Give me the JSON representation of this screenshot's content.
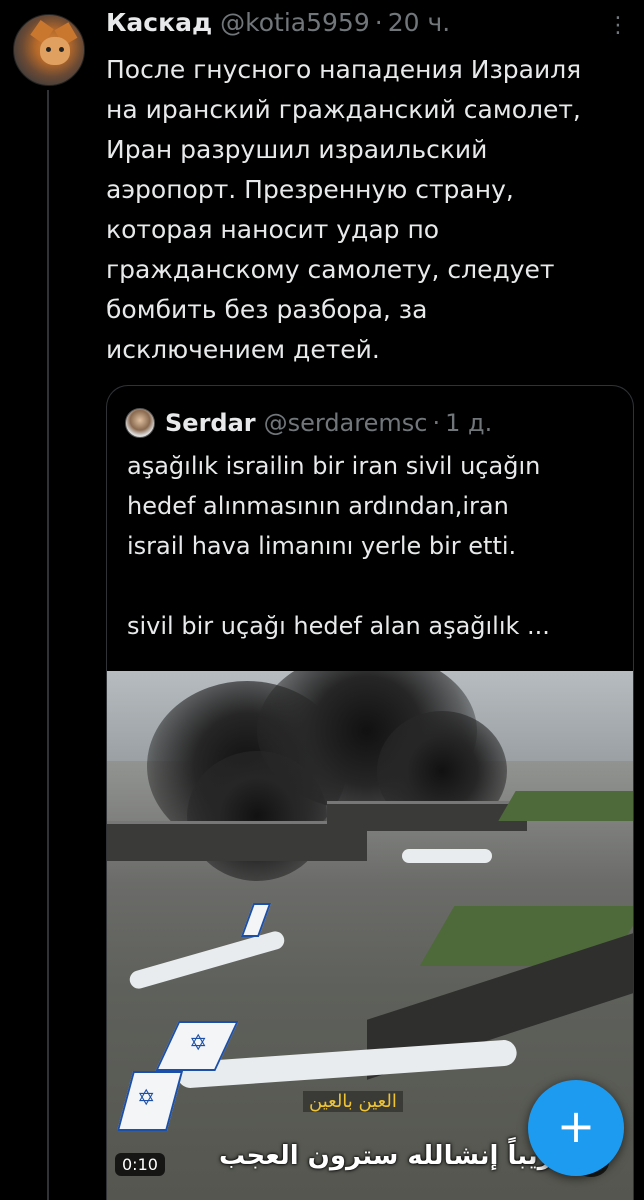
{
  "tweet": {
    "author_name": "Каскад",
    "author_handle": "@kotia5959",
    "separator": "·",
    "time": "20 ч.",
    "lines": [
      "После гнусного нападения Израиля",
      "на иранский гражданский самолет,",
      "Иран разрушил израильский",
      "аэропорт.  Презренную страну,",
      "которая наносит удар по",
      "гражданскому самолету, следует",
      "бомбить без разбора, за",
      "исключением детей."
    ],
    "more_icon": "ellipsis-icon"
  },
  "quote": {
    "author_name": "Serdar",
    "author_handle": "@serdaremsc",
    "separator": "·",
    "time": "1 д.",
    "lines": [
      "aşağılık israilin bir iran sivil uçağın",
      "hedef alınmasının ardından,iran",
      "israil hava limanını yerle bir etti.",
      "",
      "sivil bir uçağı hedef alan aşağılık ..."
    ],
    "video": {
      "time": "0:10",
      "caption_top": "العين بالعين",
      "caption_bottom": "قريباً إنشالله سترون العجب",
      "mute_icon": "speaker-muted-icon"
    }
  },
  "fab": {
    "label": "+",
    "icon": "plus-icon",
    "color": "#1d9bf0"
  }
}
